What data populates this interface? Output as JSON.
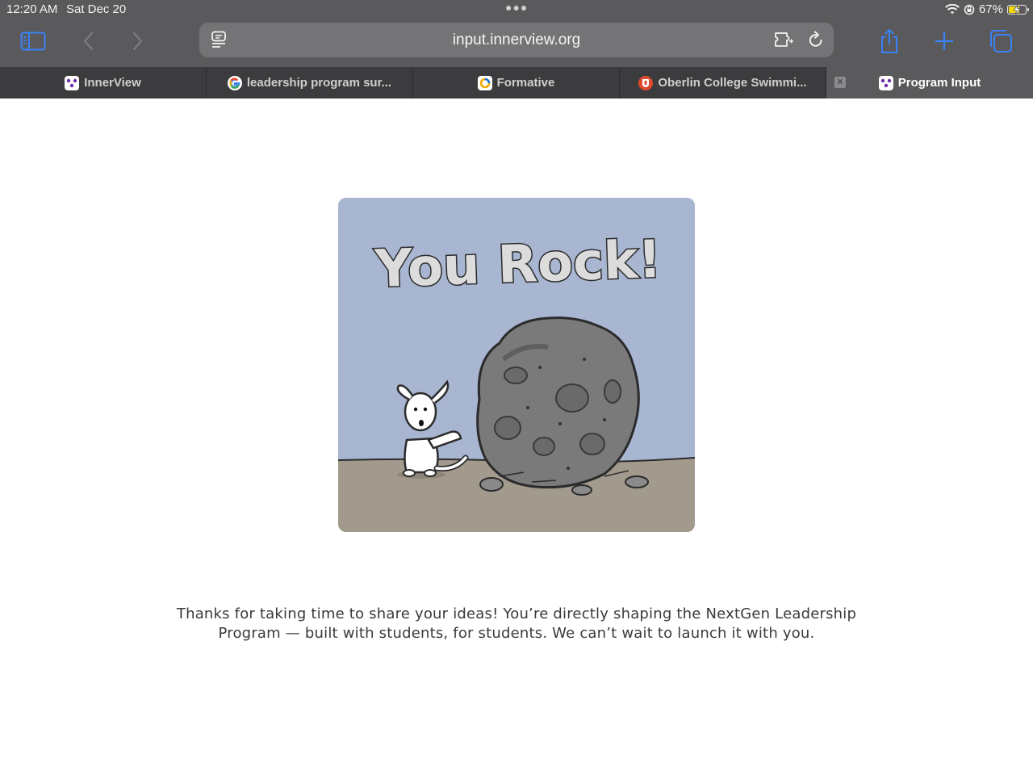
{
  "status_bar": {
    "time": "12:20 AM",
    "date": "Sat Dec 20",
    "battery_percent": "67%",
    "battery_level": 0.67,
    "icons": [
      "wifi-icon",
      "orientation-lock-icon",
      "battery-charging-icon"
    ]
  },
  "toolbar": {
    "url": "input.innerview.org",
    "icons": [
      "sidebar-icon",
      "back-icon",
      "forward-icon",
      "reader-icon",
      "extension-icon",
      "reload-icon",
      "share-icon",
      "new-tab-icon",
      "tab-overview-icon"
    ]
  },
  "tabs": [
    {
      "label": "InnerView",
      "icon": "innerview-favicon",
      "active": false
    },
    {
      "label": "leadership program sur...",
      "icon": "google-favicon",
      "active": false
    },
    {
      "label": "Formative",
      "icon": "formative-favicon",
      "active": false
    },
    {
      "label": "Oberlin College Swimmi...",
      "icon": "oberlin-favicon",
      "active": false
    },
    {
      "label": "Program Input",
      "icon": "innerview-favicon",
      "active": true
    }
  ],
  "content": {
    "image_caption": "You Rock!",
    "message_line1": "Thanks for taking  time to share your ideas! You’re directly shaping the NextGen Leadership",
    "message_line2": "Program — built with students, for students. We can’t wait to launch it with you."
  },
  "colors": {
    "chrome": "#5a5a5c",
    "tab_bar": "#3c3c3e",
    "accent_blue": "#3b82f6",
    "card_sky": "#a8b6d2",
    "card_ground": "#a39a8e"
  }
}
